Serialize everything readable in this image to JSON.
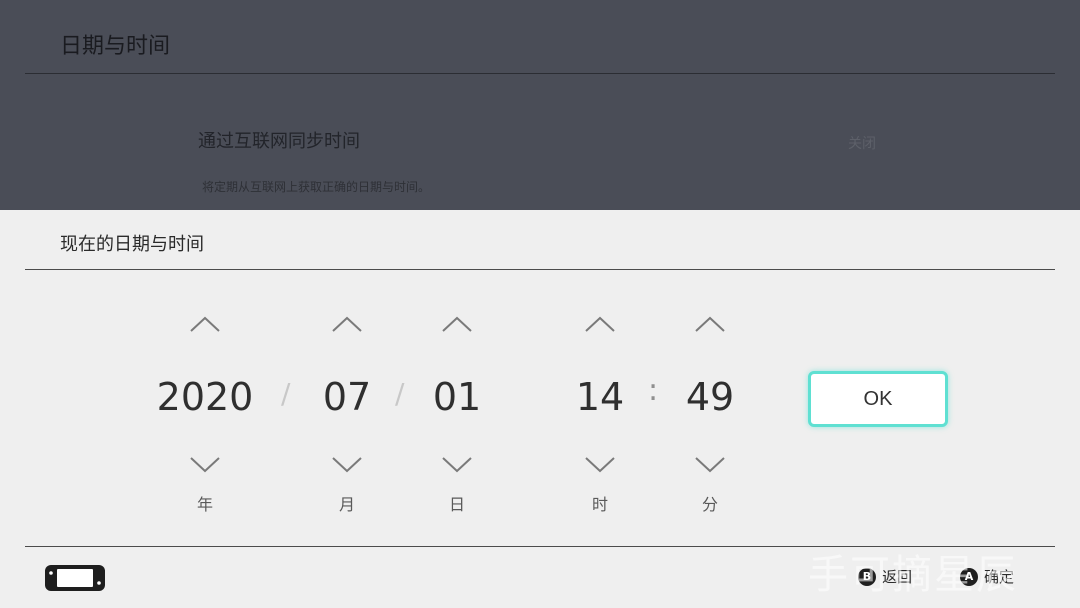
{
  "background": {
    "title": "日期与时间",
    "setting_label": "通过互联网同步时间",
    "setting_value": "关闭",
    "setting_description": "将定期从互联网上获取正确的日期与时间。"
  },
  "dialog": {
    "title": "现在的日期与时间",
    "fields": {
      "year": {
        "value": "2020",
        "unit": "年"
      },
      "month": {
        "value": "07",
        "unit": "月"
      },
      "day": {
        "value": "01",
        "unit": "日"
      },
      "hour": {
        "value": "14",
        "unit": "时"
      },
      "minute": {
        "value": "49",
        "unit": "分"
      }
    },
    "date_separator": "/",
    "time_separator": ":",
    "ok_label": "OK"
  },
  "footer": {
    "back": {
      "button": "B",
      "label": "返回"
    },
    "confirm": {
      "button": "A",
      "label": "确定"
    }
  },
  "watermark": "手可摘星辰",
  "colors": {
    "focus_accent": "#5fe0d2",
    "overlay_background": "#4a4d57",
    "dialog_background": "#efefef"
  }
}
